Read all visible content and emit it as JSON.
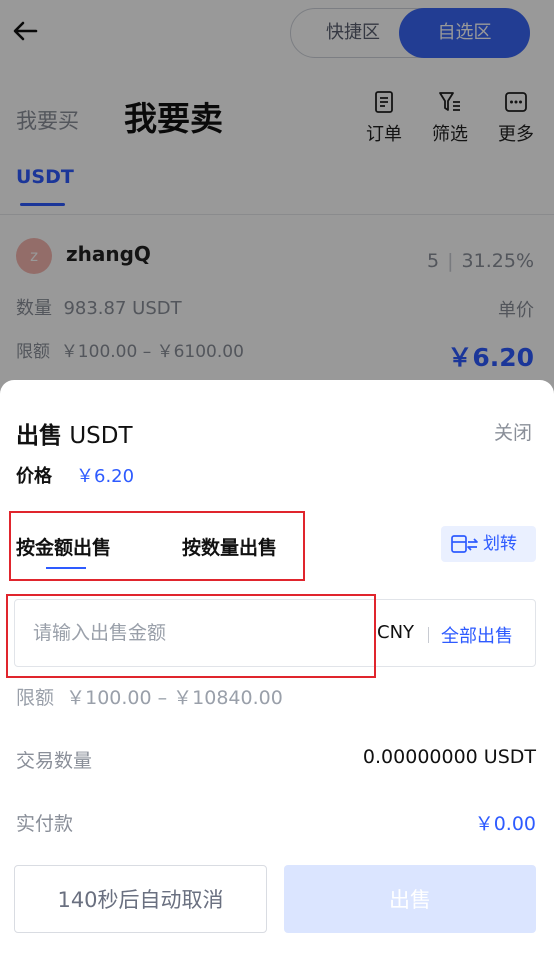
{
  "header": {
    "mode_tabs": [
      "快捷区",
      "自选区"
    ],
    "active_mode": "自选区"
  },
  "trade_tabs": {
    "buy": "我要买",
    "sell": "我要卖"
  },
  "tools": [
    {
      "icon": "order-icon",
      "label": "订单"
    },
    {
      "icon": "filter-icon",
      "label": "筛选"
    },
    {
      "icon": "more-icon",
      "label": "更多"
    }
  ],
  "coin_tab": "USDT",
  "listing": {
    "avatar_letter": "z",
    "merchant": "zhangQ",
    "orders": "5",
    "completion": "31.25%",
    "quantity_label": "数量",
    "quantity": "983.87 USDT",
    "unit_price_label": "单价",
    "limit_label": "限额",
    "limit": "￥100.00 – ￥6100.00",
    "price": "￥6.20"
  },
  "sheet": {
    "title_bold": "出售",
    "title_coin": "USDT",
    "close": "关闭",
    "price_label": "价格",
    "price": "￥6.20",
    "tabs": {
      "by_amount": "按金额出售",
      "by_quantity": "按数量出售"
    },
    "transfer": "划转",
    "input_placeholder": "请输入出售金额",
    "currency": "CNY",
    "sell_all": "全部出售",
    "limit_label": "限额",
    "limit": "￥100.00 – ￥10840.00",
    "tx_qty_label": "交易数量",
    "tx_qty": "0.00000000 USDT",
    "pay_label": "实付款",
    "pay": "￥0.00",
    "cancel_button": "140秒后自动取消",
    "sell_button": "出售"
  },
  "colors": {
    "accent": "#2e5bff",
    "highlight_box": "#e0252d",
    "disabled_button": "#dbe5ff"
  }
}
